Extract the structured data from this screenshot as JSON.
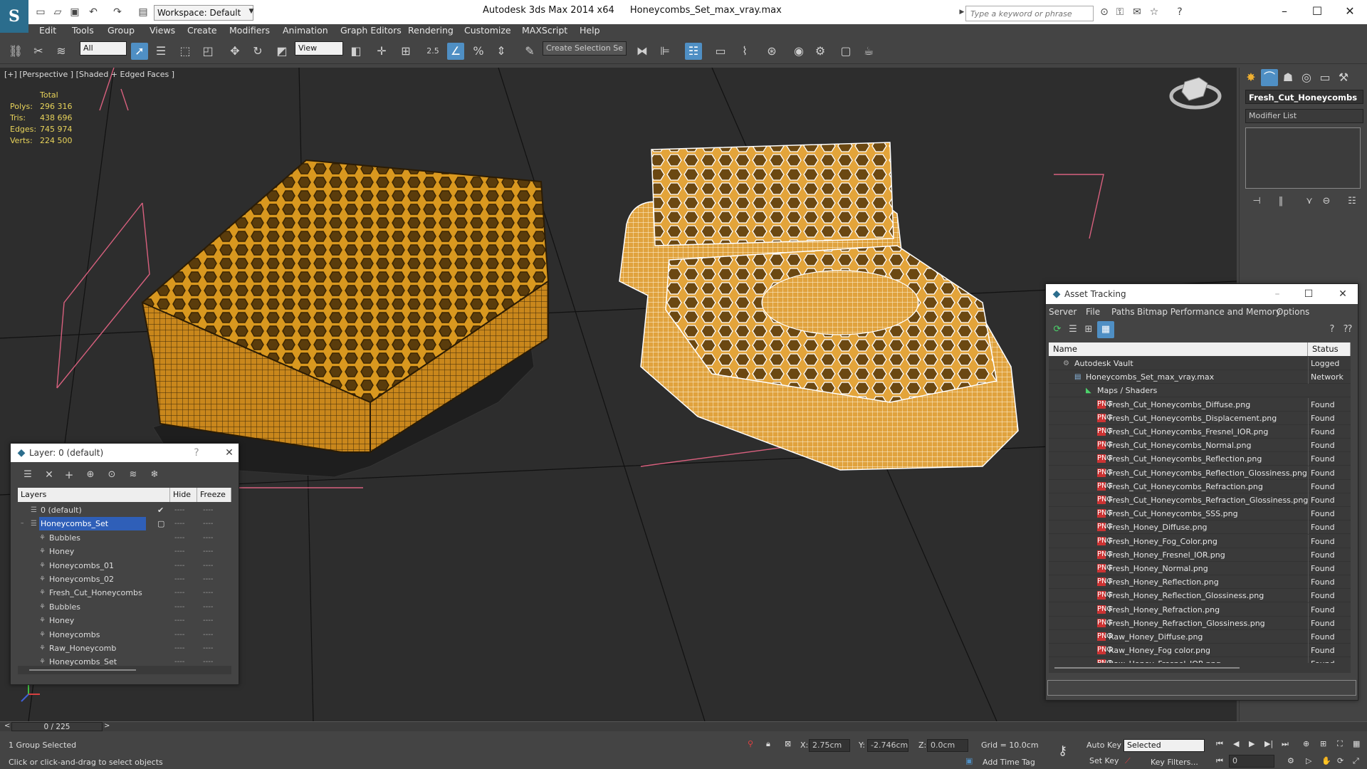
{
  "title_bar": {
    "workspace": "Workspace: Default",
    "app_title": "Autodesk 3ds Max  2014 x64",
    "file_title": "Honeycombs_Set_max_vray.max",
    "search_placeholder": "Type a keyword or phrase"
  },
  "menu": [
    "Edit",
    "Tools",
    "Group",
    "Views",
    "Create",
    "Modifiers",
    "Animation",
    "Graph Editors",
    "Rendering",
    "Customize",
    "MAXScript",
    "Help"
  ],
  "toolbar": {
    "filter_combo": "All",
    "refcoord_combo": "View",
    "snap_label": "2.5",
    "selection_set": "Create Selection Se"
  },
  "viewport": {
    "label": "[+] [Perspective ] [Shaded + Edged Faces ]",
    "stats_header": "Total",
    "stats": [
      {
        "label": "Polys:",
        "value": "296 316"
      },
      {
        "label": "Tris:",
        "value": "438 696"
      },
      {
        "label": "Edges:",
        "value": "745 974"
      },
      {
        "label": "Verts:",
        "value": "224 500"
      }
    ]
  },
  "command_panel": {
    "object_name": "Fresh_Cut_Honeycombs",
    "modifier_list": "Modifier List"
  },
  "layer_dialog": {
    "title": "Layer: 0 (default)",
    "headers": {
      "layers": "Layers",
      "hide": "Hide",
      "freeze": "Freeze"
    },
    "rows": [
      {
        "name": "0 (default)",
        "level": 1,
        "checked": true
      },
      {
        "name": "Honeycombs_Set",
        "level": 1,
        "selected": true
      },
      {
        "name": "Bubbles",
        "level": 2
      },
      {
        "name": "Honey",
        "level": 2
      },
      {
        "name": "Honeycombs_01",
        "level": 2
      },
      {
        "name": "Honeycombs_02",
        "level": 2
      },
      {
        "name": "Fresh_Cut_Honeycombs",
        "level": 2
      },
      {
        "name": "Bubbles",
        "level": 2
      },
      {
        "name": "Honey",
        "level": 2
      },
      {
        "name": "Honeycombs",
        "level": 2
      },
      {
        "name": "Raw_Honeycomb",
        "level": 2
      },
      {
        "name": "Honeycombs_Set",
        "level": 2
      }
    ],
    "dash": "----"
  },
  "asset_dialog": {
    "title": "Asset Tracking",
    "menu": [
      "Server",
      "File",
      "Paths",
      "Bitmap Performance and Memory",
      "Options"
    ],
    "headers": {
      "name": "Name",
      "status": "Status"
    },
    "rows": [
      {
        "name": "Autodesk Vault",
        "status": "Logged",
        "level": 1,
        "type": "vault"
      },
      {
        "name": "Honeycombs_Set_max_vray.max",
        "status": "Network",
        "level": 2,
        "type": "max"
      },
      {
        "name": "Maps / Shaders",
        "status": "",
        "level": 3,
        "type": "folder"
      },
      {
        "name": "Fresh_Cut_Honeycombs_Diffuse.png",
        "status": "Found",
        "level": 4,
        "type": "png"
      },
      {
        "name": "Fresh_Cut_Honeycombs_Displacement.png",
        "status": "Found",
        "level": 4,
        "type": "png"
      },
      {
        "name": "Fresh_Cut_Honeycombs_Fresnel_IOR.png",
        "status": "Found",
        "level": 4,
        "type": "png"
      },
      {
        "name": "Fresh_Cut_Honeycombs_Normal.png",
        "status": "Found",
        "level": 4,
        "type": "png"
      },
      {
        "name": "Fresh_Cut_Honeycombs_Reflection.png",
        "status": "Found",
        "level": 4,
        "type": "png"
      },
      {
        "name": "Fresh_Cut_Honeycombs_Reflection_Glossiness.png",
        "status": "Found",
        "level": 4,
        "type": "png"
      },
      {
        "name": "Fresh_Cut_Honeycombs_Refraction.png",
        "status": "Found",
        "level": 4,
        "type": "png"
      },
      {
        "name": "Fresh_Cut_Honeycombs_Refraction_Glossiness.png",
        "status": "Found",
        "level": 4,
        "type": "png"
      },
      {
        "name": "Fresh_Cut_Honeycombs_SSS.png",
        "status": "Found",
        "level": 4,
        "type": "png"
      },
      {
        "name": "Fresh_Honey_Diffuse.png",
        "status": "Found",
        "level": 4,
        "type": "png"
      },
      {
        "name": "Fresh_Honey_Fog_Color.png",
        "status": "Found",
        "level": 4,
        "type": "png"
      },
      {
        "name": "Fresh_Honey_Fresnel_IOR.png",
        "status": "Found",
        "level": 4,
        "type": "png"
      },
      {
        "name": "Fresh_Honey_Normal.png",
        "status": "Found",
        "level": 4,
        "type": "png"
      },
      {
        "name": "Fresh_Honey_Reflection.png",
        "status": "Found",
        "level": 4,
        "type": "png"
      },
      {
        "name": "Fresh_Honey_Reflection_Glossiness.png",
        "status": "Found",
        "level": 4,
        "type": "png"
      },
      {
        "name": "Fresh_Honey_Refraction.png",
        "status": "Found",
        "level": 4,
        "type": "png"
      },
      {
        "name": "Fresh_Honey_Refraction_Glossiness.png",
        "status": "Found",
        "level": 4,
        "type": "png"
      },
      {
        "name": "Raw_Honey_Diffuse.png",
        "status": "Found",
        "level": 4,
        "type": "png"
      },
      {
        "name": "Raw_Honey_Fog color.png",
        "status": "Found",
        "level": 4,
        "type": "png"
      },
      {
        "name": "Raw_Honey_Fresnel_IOR.png",
        "status": "Found",
        "level": 4,
        "type": "png"
      }
    ]
  },
  "status": {
    "frame_counter": "0 / 225",
    "selection": "1 Group Selected",
    "prompt": "Click or click-and-drag to select objects",
    "x_label": "X:",
    "x_value": "2.75cm",
    "y_label": "Y:",
    "y_value": "-2.746cm",
    "z_label": "Z:",
    "z_value": "0.0cm",
    "grid": "Grid = 10.0cm",
    "auto_key": "Auto Key",
    "set_key": "Set Key",
    "key_mode": "Selected",
    "key_filters": "Key Filters...",
    "add_time_tag": "Add Time Tag",
    "frame": "0"
  },
  "colors": {
    "accent": "#4f8fc4",
    "viewport_bg": "#2d2d2d",
    "honey": "#d99a2b",
    "stats": "#e8d35a",
    "selection": "#2f5fb8"
  }
}
